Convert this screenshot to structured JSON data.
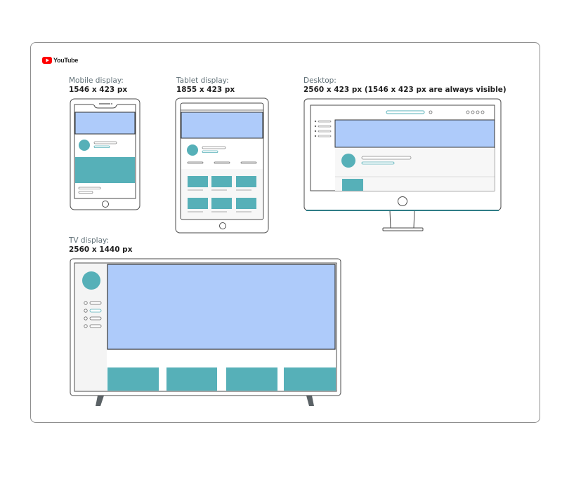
{
  "logo": {
    "wordmark": "YouTube",
    "play_color": "#ff0000"
  },
  "devices": {
    "mobile": {
      "label": "Mobile display:",
      "spec": "1546 x 423 px"
    },
    "tablet": {
      "label": "Tablet display:",
      "spec": "1855 x 423 px"
    },
    "desktop": {
      "label": "Desktop:",
      "spec": "2560 x 423 px (1546 x 423 px are always visible)"
    },
    "tv": {
      "label": "TV display:",
      "spec": "2560 x 1440 px"
    }
  },
  "colors": {
    "banner": "#aecbfa",
    "teal": "#56b0b8",
    "outline": "#4a4a4a",
    "desktop_base": "#2f7d87",
    "tv_stand": "#5b6266"
  }
}
